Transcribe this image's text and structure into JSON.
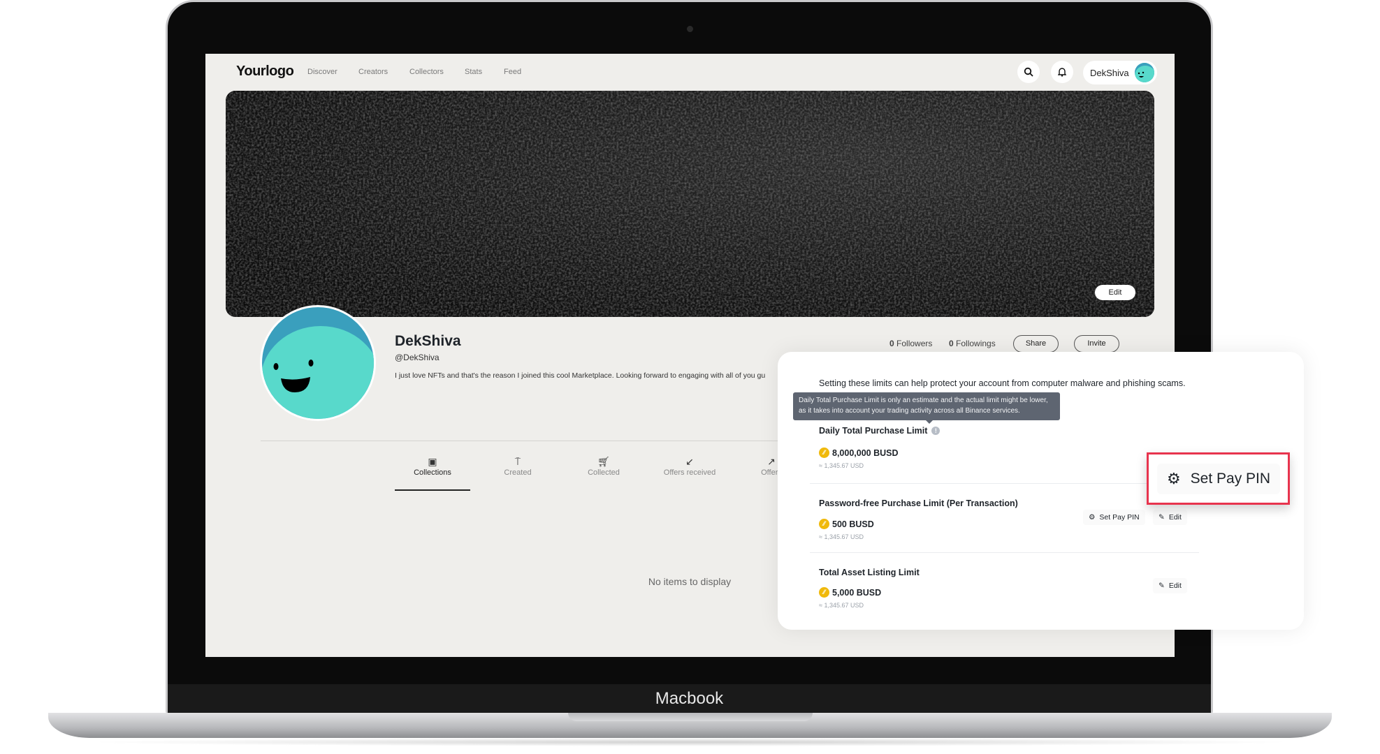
{
  "device": {
    "label": "Macbook"
  },
  "header": {
    "logo": "Yourlogo",
    "nav": [
      "Discover",
      "Creators",
      "Collectors",
      "Stats",
      "Feed"
    ],
    "user_name": "DekShiva",
    "icons": {
      "search": "search-icon",
      "notifications": "bell-icon"
    }
  },
  "banner": {
    "edit_label": "Edit"
  },
  "profile": {
    "name": "DekShiva",
    "handle": "@DekShiva",
    "bio": "I just love NFTs and that's the reason I joined this cool Marketplace. Looking forward to engaging with all of you gu",
    "followers_count": "0",
    "followers_label": "Followers",
    "followings_count": "0",
    "followings_label": "Followings",
    "share_label": "Share",
    "invite_label": "Invite"
  },
  "tabs": [
    {
      "label": "Collections",
      "icon": "collections-icon",
      "active": true
    },
    {
      "label": "Created",
      "icon": "paint-roller-icon"
    },
    {
      "label": "Collected",
      "icon": "cart-icon"
    },
    {
      "label": "Offers received",
      "icon": "arrow-down-left-icon"
    },
    {
      "label": "Offers",
      "icon": "arrow-up-right-icon"
    }
  ],
  "empty_state": "No items to display",
  "limits_panel": {
    "intro": "Setting these limits can help protect your account from computer malware and phishing scams.",
    "tooltip": "Daily Total Purchase Limit is only an estimate and the actual limit might be lower, as it takes into account your trading activity across all Binance services.",
    "items": [
      {
        "title": "Daily Total Purchase Limit",
        "amount": "8,000,000 BUSD",
        "usd": "≈ 1,345.67 USD"
      },
      {
        "title": "Password-free Purchase Limit (Per Transaction)",
        "amount": "500 BUSD",
        "usd": "≈ 1,345.67 USD",
        "set_pin_label": "Set Pay PIN",
        "edit_label": "Edit"
      },
      {
        "title": "Total Asset Listing Limit",
        "amount": "5,000 BUSD",
        "usd": "≈ 1,345.67 USD",
        "edit_label": "Edit"
      }
    ],
    "highlight_label": "Set Pay PIN"
  },
  "colors": {
    "accent_coin": "#f0b90b",
    "highlight": "#e8344e",
    "avatar_teal": "#58d9cb",
    "avatar_blue": "#3a9fbd"
  }
}
